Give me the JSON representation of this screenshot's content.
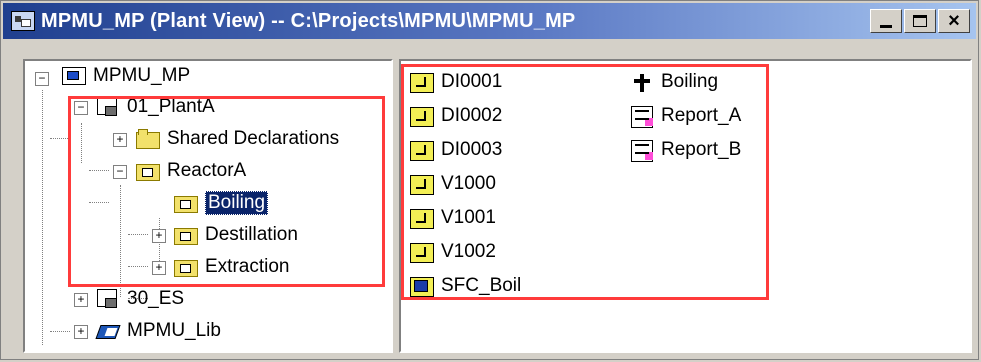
{
  "window": {
    "title": "MPMU_MP (Plant View) -- C:\\Projects\\MPMU\\MPMU_MP",
    "buttons": {
      "minimize": "_",
      "maximize": "□",
      "close": "×"
    }
  },
  "tree": {
    "items": [
      {
        "label": "MPMU_MP",
        "level": 0,
        "expanded": true,
        "icon": "project-icon"
      },
      {
        "label": "01_PlantA",
        "level": 1,
        "expanded": true,
        "icon": "plant-icon"
      },
      {
        "label": "Shared Declarations",
        "level": 2,
        "expanded": false,
        "icon": "folder-icon"
      },
      {
        "label": "ReactorA",
        "level": 2,
        "expanded": true,
        "icon": "folder-plant-icon"
      },
      {
        "label": "Boiling",
        "level": 3,
        "selected": true,
        "icon": "folder-plant-icon"
      },
      {
        "label": "Destillation",
        "level": 3,
        "expanded": false,
        "icon": "folder-plant-icon"
      },
      {
        "label": "Extraction",
        "level": 3,
        "expanded": false,
        "icon": "folder-plant-icon"
      },
      {
        "label": "30_ES",
        "level": 1,
        "expanded": false,
        "icon": "plant-icon"
      },
      {
        "label": "MPMU_Lib",
        "level": 1,
        "expanded": false,
        "icon": "library-icon"
      }
    ]
  },
  "list": {
    "left_column": [
      {
        "label": "DI0001",
        "icon": "block-icon"
      },
      {
        "label": "DI0002",
        "icon": "block-icon"
      },
      {
        "label": "DI0003",
        "icon": "block-icon"
      },
      {
        "label": "V1000",
        "icon": "block-icon"
      },
      {
        "label": "V1001",
        "icon": "block-icon"
      },
      {
        "label": "V1002",
        "icon": "block-icon"
      },
      {
        "label": "SFC_Boil",
        "icon": "sfc-icon"
      }
    ],
    "right_column": [
      {
        "label": "Boiling",
        "icon": "equipment-icon"
      },
      {
        "label": "Report_A",
        "icon": "report-icon"
      },
      {
        "label": "Report_B",
        "icon": "report-icon"
      }
    ]
  },
  "colors": {
    "highlight": "#ff3b3b",
    "selection": "#0a246a",
    "title_start": "#1f3f8f",
    "title_end": "#a6c4ef"
  }
}
